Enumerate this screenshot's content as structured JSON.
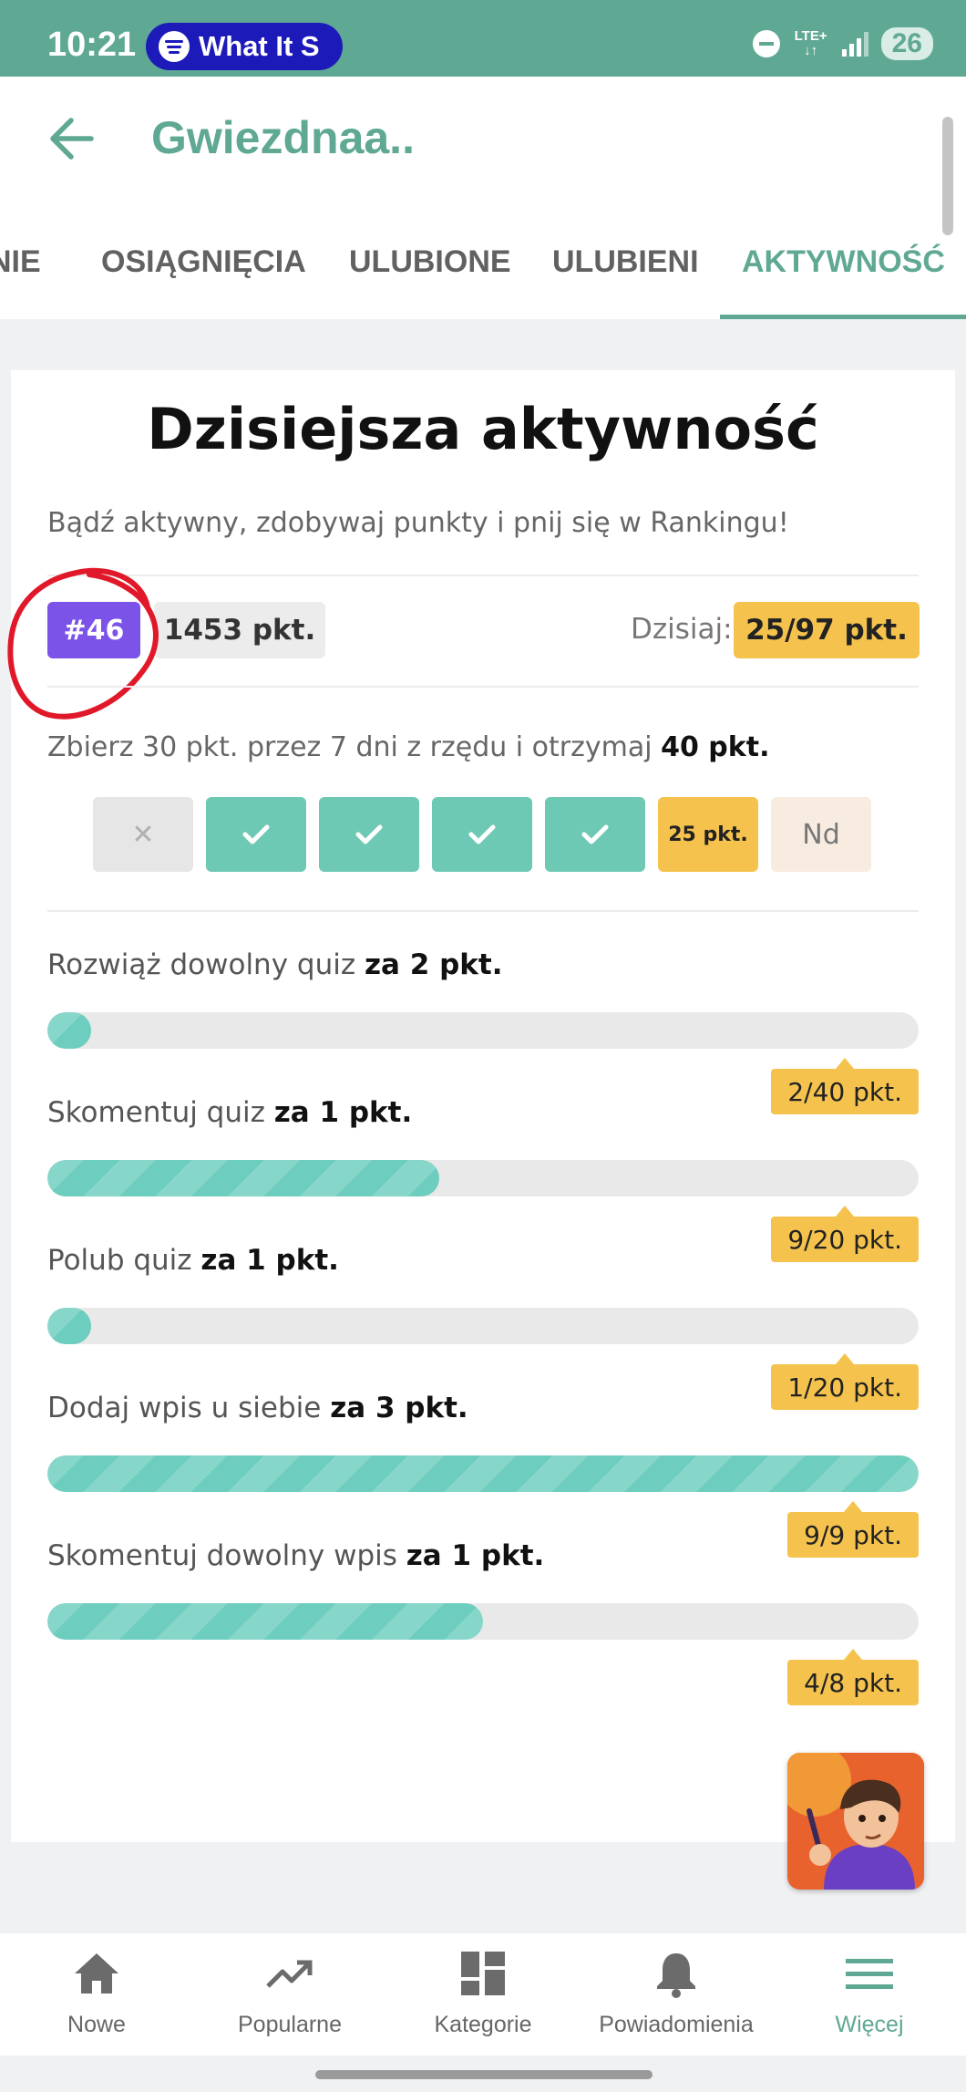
{
  "status_bar": {
    "time": "10:21",
    "media_pill": "What It S",
    "network": "LTE+",
    "battery": "26"
  },
  "header": {
    "title": "Gwiezdnaa..",
    "tabs": [
      {
        "label": "NIE",
        "active": false
      },
      {
        "label": "OSIĄGNIĘCIA",
        "active": false
      },
      {
        "label": "ULUBIONE",
        "active": false
      },
      {
        "label": "ULUBIENI",
        "active": false
      },
      {
        "label": "AKTYWNOŚĆ",
        "active": true
      }
    ]
  },
  "activity": {
    "title": "Dzisiejsza aktywność",
    "subtitle": "Bądź aktywny, zdobywaj punkty i pnij się w Rankingu!",
    "rank": "#46",
    "total_points": "1453 pkt.",
    "today_label": "Dzisiaj:",
    "today_value": "25/97 pkt.",
    "streak_text": "Zbierz 30 pkt. przez 7 dni z rzędu i otrzymaj",
    "streak_reward": "40 pkt.",
    "days": [
      {
        "state": "missed",
        "label": "✕"
      },
      {
        "state": "done",
        "label": "✔"
      },
      {
        "state": "done",
        "label": "✔"
      },
      {
        "state": "done",
        "label": "✔"
      },
      {
        "state": "done",
        "label": "✔"
      },
      {
        "state": "today",
        "label": "25 pkt."
      },
      {
        "state": "future",
        "label": "Nd"
      }
    ],
    "tasks": [
      {
        "label": "Rozwiąż dowolny quiz",
        "reward": "za 2 pkt.",
        "progress": "2/40 pkt.",
        "fraction": 0.05
      },
      {
        "label": "Skomentuj quiz",
        "reward": "za 1 pkt.",
        "progress": "9/20 pkt.",
        "fraction": 0.45
      },
      {
        "label": "Polub quiz",
        "reward": "za 1 pkt.",
        "progress": "1/20 pkt.",
        "fraction": 0.05
      },
      {
        "label": "Dodaj wpis u siebie",
        "reward": "za 3 pkt.",
        "progress": "9/9 pkt.",
        "fraction": 1.0
      },
      {
        "label": "Skomentuj dowolny wpis",
        "reward": "za 1 pkt.",
        "progress": "4/8 pkt.",
        "fraction": 0.5
      }
    ]
  },
  "bottom_nav": [
    {
      "label": "Nowe",
      "icon": "home-icon",
      "active": false
    },
    {
      "label": "Popularne",
      "icon": "trending-icon",
      "active": false
    },
    {
      "label": "Kategorie",
      "icon": "categories-icon",
      "active": false
    },
    {
      "label": "Powiadomienia",
      "icon": "bell-icon",
      "active": false
    },
    {
      "label": "Więcej",
      "icon": "menu-icon",
      "active": true
    }
  ],
  "colors": {
    "accent": "#5fa893",
    "progress": "#6dcdbe",
    "rank": "#7b53e8",
    "highlight": "#f5c34d",
    "annotation": "#e0182a"
  }
}
